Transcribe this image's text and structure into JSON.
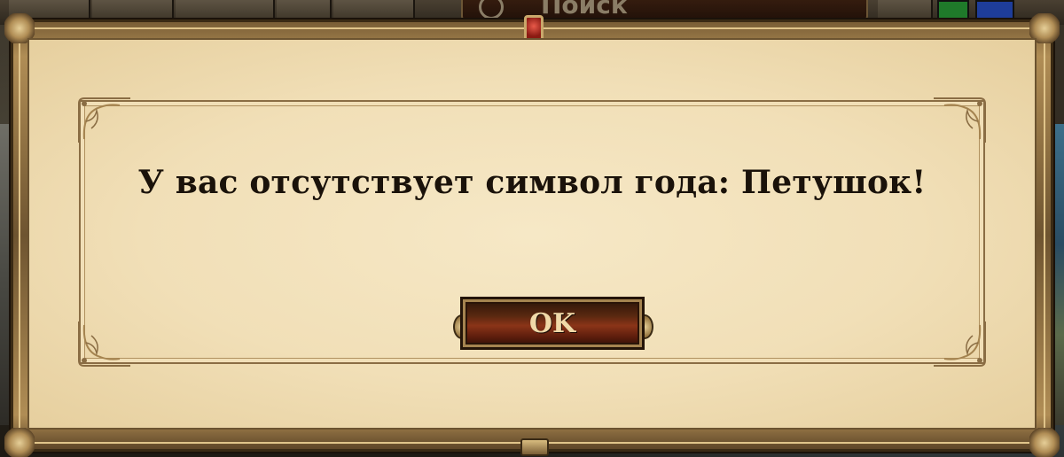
{
  "background": {
    "search": {
      "label": "Поиск",
      "icon": "search-icon"
    },
    "colors": {
      "green_tile": "#1f7a2a",
      "blue_tile": "#1e3d9a"
    }
  },
  "dialog": {
    "message": "У вас отсутствует символ года: Петушок!",
    "ok_button_label": "OK",
    "colors": {
      "parchment": "#f1dfb7",
      "frame": "#b08d55",
      "button": "#8a3418",
      "button_text": "#f0d9a8",
      "gem": "#e85a4a"
    }
  }
}
